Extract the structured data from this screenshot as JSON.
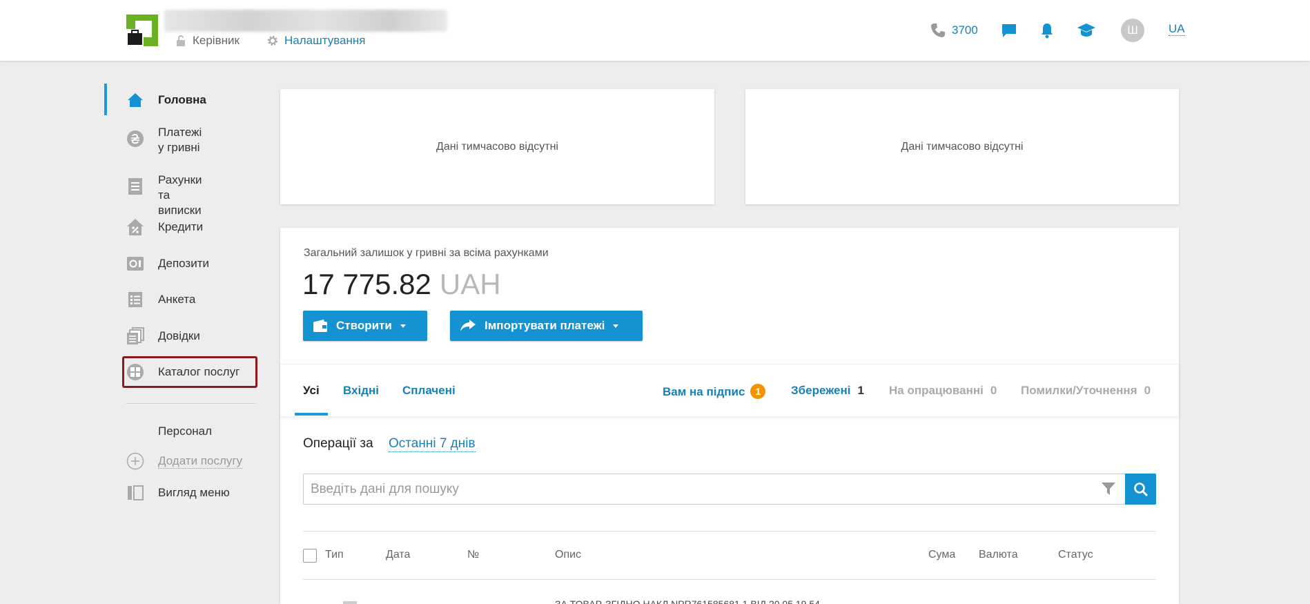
{
  "header": {
    "role_label": "Керівник",
    "settings_label": "Налаштування",
    "phone_number": "3700",
    "avatar_initial": "Ш",
    "language": "UA"
  },
  "sidebar": {
    "items": [
      {
        "id": "home",
        "label": "Головна",
        "icon": "home-icon",
        "active": true
      },
      {
        "id": "payments",
        "label": "Платежі\nу гривні",
        "icon": "hryvnia-icon"
      },
      {
        "id": "accounts",
        "label": "Рахунки та\nвиписки",
        "icon": "document-icon"
      },
      {
        "id": "credits",
        "label": "Кредити",
        "icon": "house-percent-icon"
      },
      {
        "id": "deposits",
        "label": "Депозити",
        "icon": "safe-icon"
      },
      {
        "id": "form",
        "label": "Анкета",
        "icon": "list-icon"
      },
      {
        "id": "references",
        "label": "Довідки",
        "icon": "stacked-docs-icon"
      },
      {
        "id": "catalog",
        "label": "Каталог послуг",
        "icon": "grid-circle-icon"
      }
    ],
    "personal_label": "Персонал",
    "add_service_label": "Додати послугу",
    "menu_view_label": "Вигляд меню"
  },
  "cards": {
    "left_empty": "Дані тимчасово відсутні",
    "right_empty": "Дані тимчасово відсутні"
  },
  "balance": {
    "label": "Загальний залишок у гривні за всіма рахунками",
    "amount": "17 775.82",
    "currency": "UAH"
  },
  "buttons": {
    "create": "Створити",
    "import": "Імпортувати платежі"
  },
  "tabs": {
    "all": "Усі",
    "incoming": "Вхідні",
    "paid": "Сплачені",
    "to_sign": "Вам на підпис",
    "to_sign_count": "1",
    "saved": "Збережені",
    "saved_count": "1",
    "processing": "На опрацюванні",
    "processing_count": "0",
    "errors": "Помилки/Уточнення",
    "errors_count": "0"
  },
  "operations": {
    "label": "Операції за",
    "period": "Останні 7 днів"
  },
  "search": {
    "placeholder": "Введіть дані для пошуку"
  },
  "table": {
    "columns": [
      "Тип",
      "Дата",
      "№",
      "Опис",
      "Сума",
      "Валюта",
      "Статус"
    ],
    "first_row_description": "ЗА ТОВАР, ЗГІДНО НАКЛ NPR761585681 1 ВІД 20.05.19 54"
  },
  "colors": {
    "accent": "#1592d1",
    "link": "#1a7fb5",
    "badge": "#f29400",
    "highlight": "#8b1a1f",
    "logo_green": "#6ab023"
  }
}
